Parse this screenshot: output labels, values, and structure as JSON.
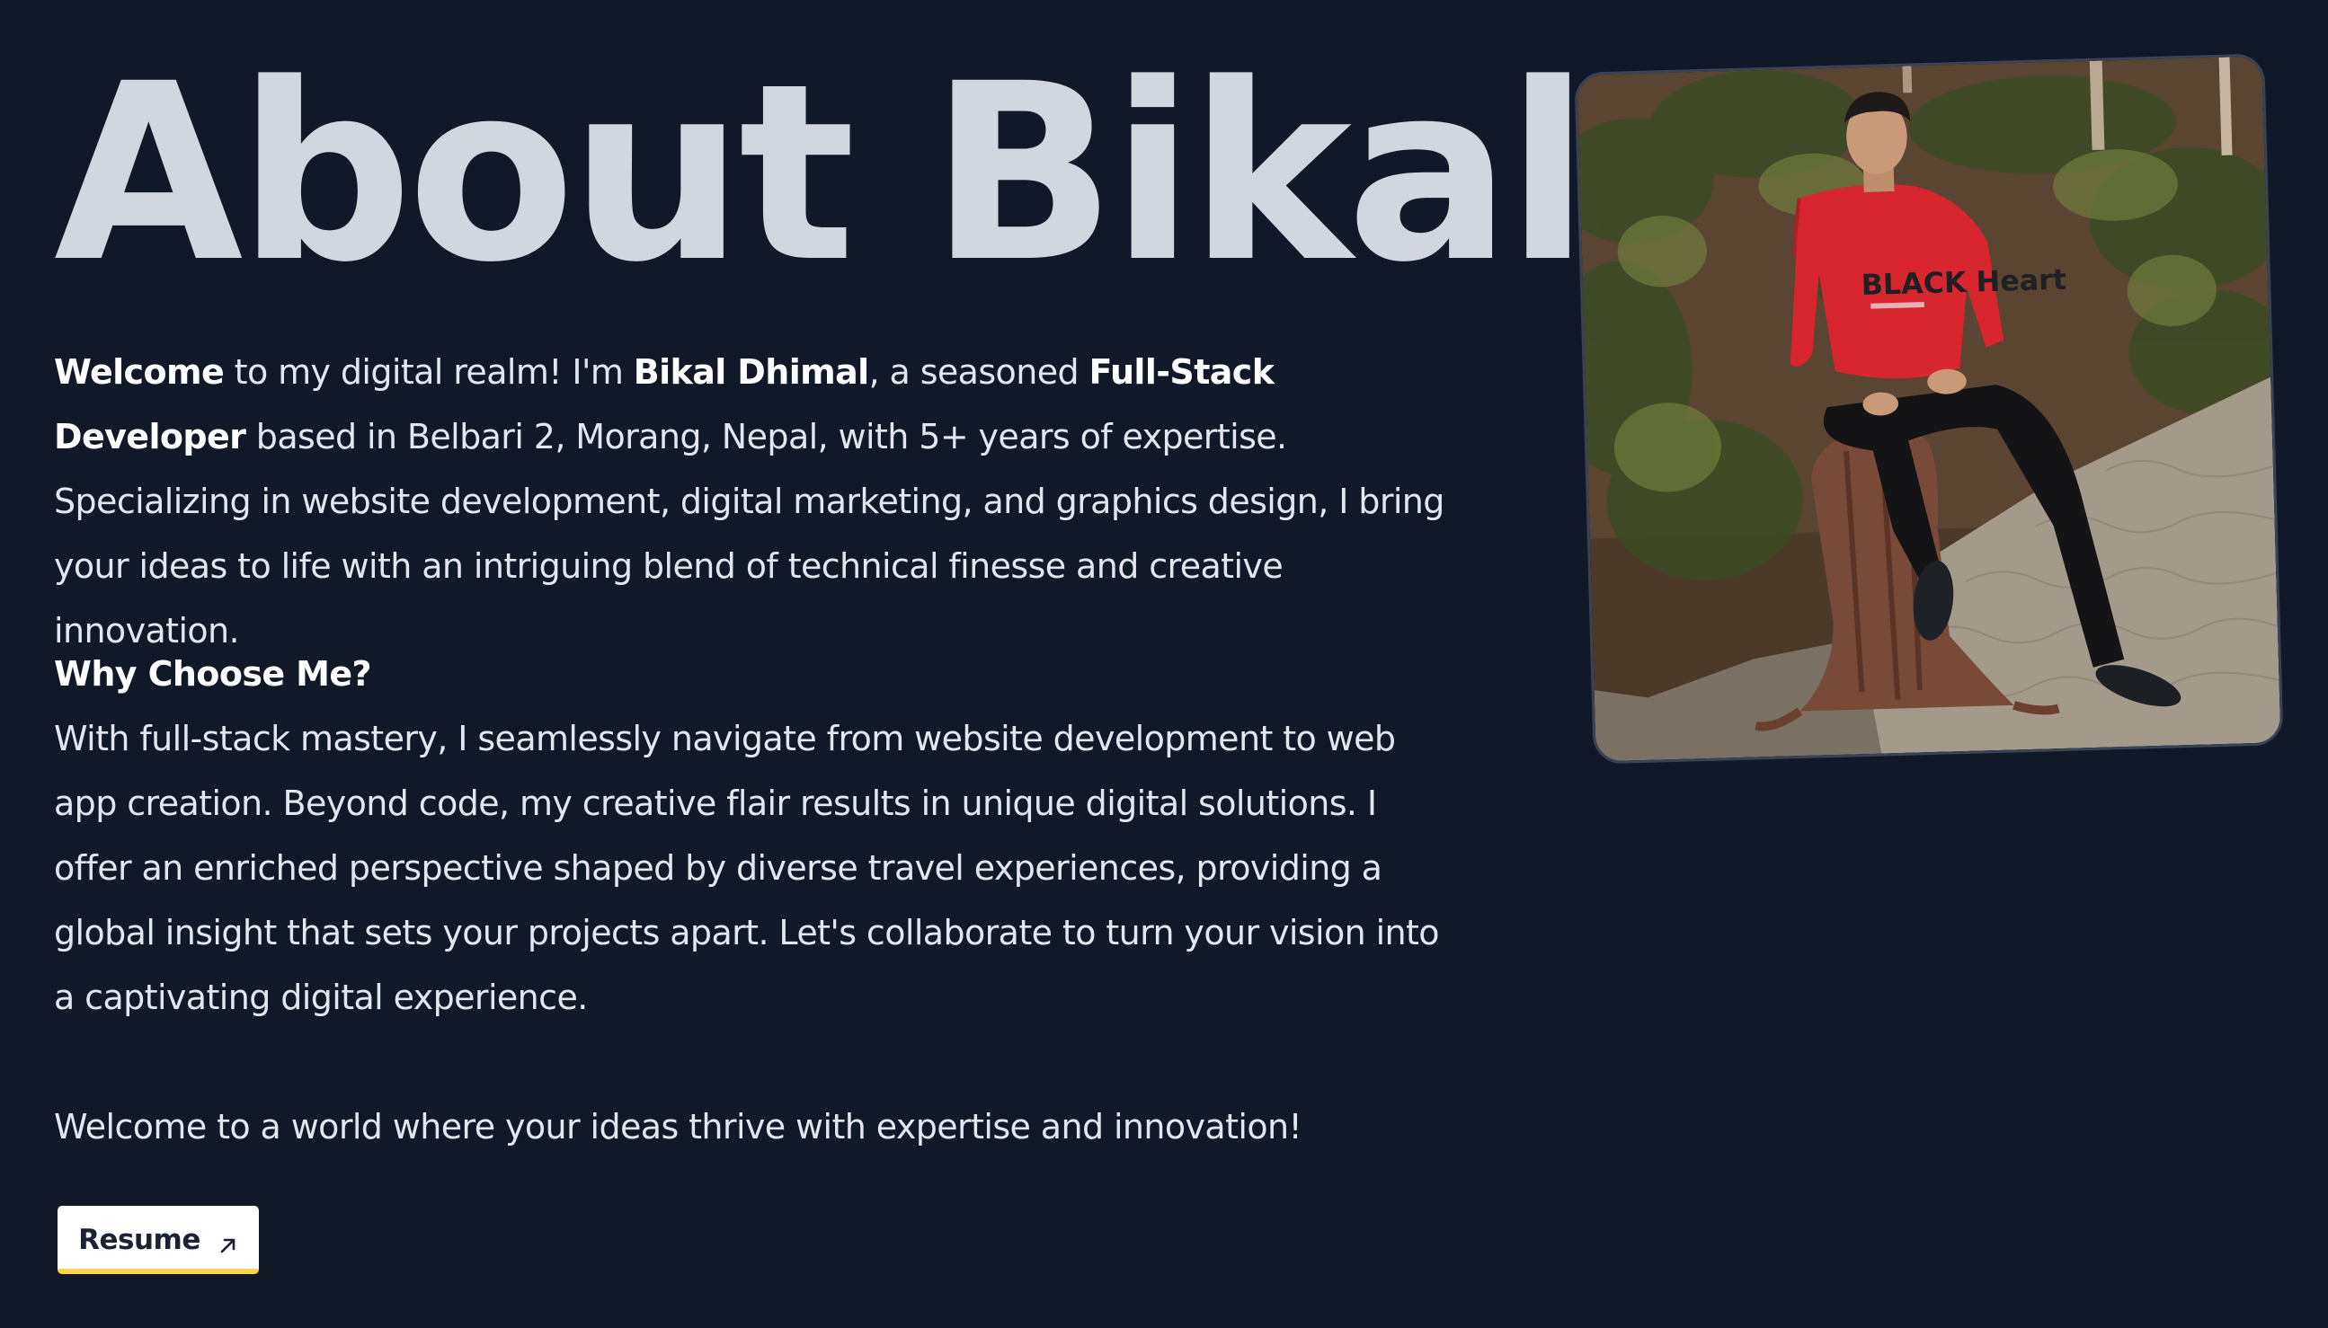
{
  "about": {
    "title": "About Bikal",
    "intro": {
      "welcome": "Welcome",
      "t1": " to my digital realm! I'm ",
      "name": "Bikal Dhimal",
      "t2": ", a seasoned ",
      "role": "Full-Stack Developer",
      "t3": " based in Belbari 2, Morang, Nepal, with 5+ years of expertise. Specializing in website development, digital marketing, and graphics design, I bring your ideas to life with an intriguing blend of technical finesse and creative innovation."
    },
    "why_heading": "Why Choose Me?",
    "why_body": "With full-stack mastery, I seamlessly navigate from website development to web app creation. Beyond code, my creative flair results in unique digital solutions. I offer an enriched perspective shaped by diverse travel experiences, providing a global insight that sets your projects apart. Let's collaborate to turn your vision into a captivating digital experience.",
    "closing": "Welcome to a world where your ideas thrive with expertise and innovation!",
    "resume_label": "Resume",
    "resume_icon": "arrow-up-right-icon",
    "sweater_text": "BLACK Heart"
  },
  "colors": {
    "background": "#111827",
    "heading": "#d2d6df",
    "text": "#e2e6ed",
    "button_bg": "#ffffff",
    "button_accent": "#fbd549"
  }
}
